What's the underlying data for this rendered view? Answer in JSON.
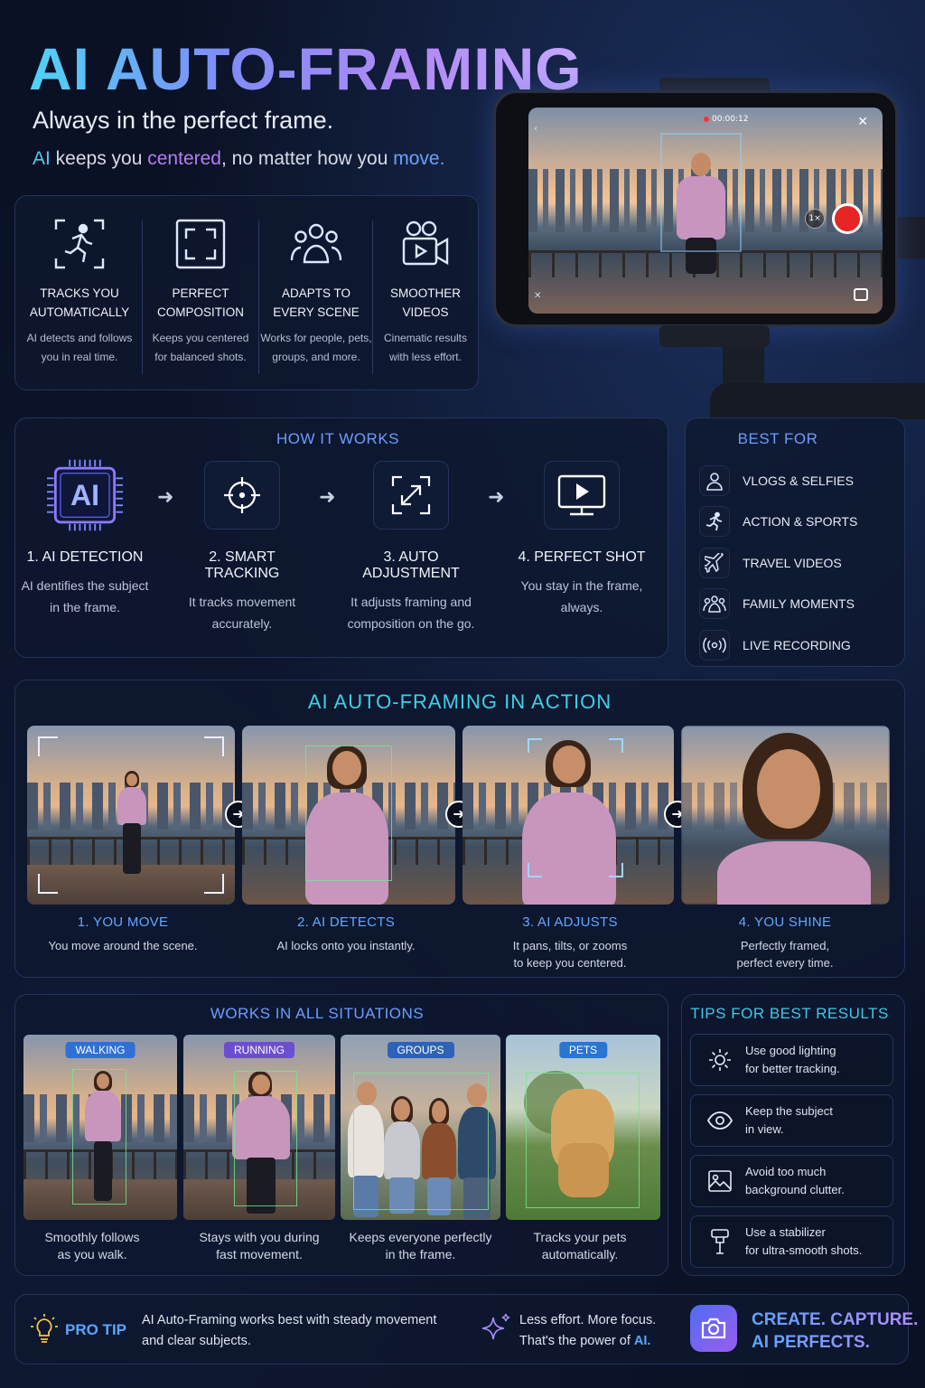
{
  "header": {
    "title": "AI AUTO-FRAMING",
    "subtitle": "Always in the perfect frame.",
    "tagline_parts": [
      "AI",
      " keeps you ",
      "centered",
      ", no matter how you ",
      "move."
    ]
  },
  "phone": {
    "timer": "00:00:12",
    "zoom": "1×"
  },
  "features": [
    {
      "icon": "running-person-icon",
      "title": "TRACKS YOU\nAUTOMATICALLY",
      "desc": "AI detects and follows\nyou in real time."
    },
    {
      "icon": "frame-icon",
      "title": "PERFECT\nCOMPOSITION",
      "desc": "Keeps you centered\nfor balanced shots."
    },
    {
      "icon": "group-icon",
      "title": "ADAPTS TO\nEVERY SCENE",
      "desc": "Works for people, pets,\ngroups, and more."
    },
    {
      "icon": "video-camera-icon",
      "title": "SMOOTHER\nVIDEOS",
      "desc": "Cinematic results\nwith less effort."
    }
  ],
  "how": {
    "heading": "HOW IT WORKS",
    "chip_label": "AI",
    "steps": [
      {
        "icon": "ai-chip-icon",
        "title": "1. AI DETECTION",
        "desc": "AI dentifies the subject\nin the frame."
      },
      {
        "icon": "crosshair-icon",
        "title": "2. SMART TRACKING",
        "desc": "It tracks movement\naccurately."
      },
      {
        "icon": "expand-icon",
        "title": "3. AUTO ADJUSTMENT",
        "desc": "It adjusts framing and\ncomposition on the go."
      },
      {
        "icon": "play-screen-icon",
        "title": "4. PERFECT SHOT",
        "desc": "You stay in the frame,\nalways."
      }
    ]
  },
  "best_for": {
    "heading": "BEST FOR",
    "items": [
      {
        "icon": "person-icon",
        "label": "VLOGS & SELFIES"
      },
      {
        "icon": "running-icon",
        "label": "ACTION & SPORTS"
      },
      {
        "icon": "airplane-icon",
        "label": "TRAVEL VIDEOS"
      },
      {
        "icon": "family-icon",
        "label": "FAMILY MOMENTS"
      },
      {
        "icon": "broadcast-icon",
        "label": "LIVE RECORDING"
      }
    ]
  },
  "action": {
    "heading": "AI AUTO-FRAMING IN ACTION",
    "steps": [
      {
        "title": "1. YOU MOVE",
        "desc": "You move around the scene."
      },
      {
        "title": "2. AI DETECTS",
        "desc": "AI locks onto you instantly."
      },
      {
        "title": "3. AI ADJUSTS",
        "desc": "It pans, tilts, or zooms\nto keep you centered."
      },
      {
        "title": "4. YOU SHINE",
        "desc": "Perfectly framed,\nperfect every time."
      }
    ]
  },
  "situations": {
    "heading": "WORKS IN ALL SITUATIONS",
    "items": [
      {
        "tag": "WALKING",
        "tag_color": "#2f6fd6",
        "caption": "Smoothly follows\nas you walk."
      },
      {
        "tag": "RUNNING",
        "tag_color": "#6b4fd0",
        "caption": "Stays with you during\nfast movement."
      },
      {
        "tag": "GROUPS",
        "tag_color": "#2e62b8",
        "caption": "Keeps everyone perfectly\nin the frame."
      },
      {
        "tag": "PETS",
        "tag_color": "#2a74d4",
        "caption": "Tracks your pets\nautomatically."
      }
    ]
  },
  "tips": {
    "heading": "TIPS FOR BEST RESULTS",
    "items": [
      {
        "icon": "sun-icon",
        "text": "Use good lighting\nfor better tracking."
      },
      {
        "icon": "eye-icon",
        "text": "Keep the subject\nin view."
      },
      {
        "icon": "image-icon",
        "text": "Avoid too much\nbackground clutter."
      },
      {
        "icon": "stabilizer-icon",
        "text": "Use a stabilizer\nfor ultra-smooth shots."
      }
    ]
  },
  "footer": {
    "pro_tip_label": "PRO TIP",
    "pro_tip_text_1": "AI Auto-Framing works best with steady movement",
    "pro_tip_text_2": "and clear subjects.",
    "focus_line_1": "Less effort. More focus.",
    "focus_line_2_prefix": "That's the power of ",
    "focus_line_2_ai": "AI.",
    "cta_line_1": "CREATE. CAPTURE.",
    "cta_line_2": "AI PERFECTS."
  },
  "colors": {
    "accent_blue": "#5aa6ff",
    "accent_purple": "#b57cf5",
    "accent_cyan": "#4fd4f5",
    "record_red": "#e62525",
    "panel_border": "#24345a"
  }
}
